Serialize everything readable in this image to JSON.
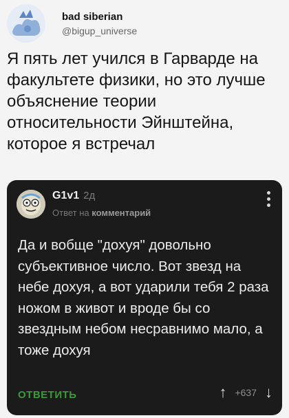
{
  "tweet": {
    "author_name": "bad siberian",
    "author_handle": "@bigup_universe",
    "text": "Я пять лет учился в Гарварде на факультете физики, но это лучше объяснение теории относительности Эйнштейна, которое я встречал"
  },
  "comment_card": {
    "username": "G1v1",
    "time_ago": "2д",
    "subtitle_prefix": "Ответ на",
    "subtitle_link": "комментарий",
    "text": "Да и вобще \"дохуя\" довольно субъективное число. Вот звезд на небе дохуя, а вот ударили тебя 2 раза ножом в живот и вроде бы со звездным небом несравнимо мало, а тоже дохуя",
    "reply_label": "ОТВЕТИТЬ",
    "vote_count": "+637"
  },
  "icons": {
    "upvote": "arrow-up-icon",
    "downvote": "arrow-down-icon",
    "menu": "more-vertical-icon"
  },
  "colors": {
    "card_background": "#1b1b1b",
    "reply_accent": "#3b9b3b",
    "page_background": "#f4f4f4"
  }
}
